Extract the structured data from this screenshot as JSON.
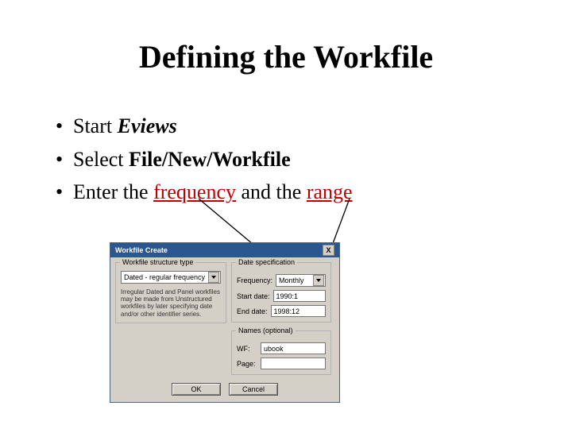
{
  "title": "Defining the Workfile",
  "bullets": {
    "b1_pre": "Start ",
    "b1_em": "Eviews",
    "b2_pre": "Select  ",
    "b2_bold": "File/New/Workfile",
    "b3_pre": "Enter the ",
    "b3_red1": "frequency",
    "b3_mid": " and the ",
    "b3_red2": "range"
  },
  "dialog": {
    "title": "Workfile Create",
    "close": "X",
    "structure_legend": "Workfile structure type",
    "structure_value": "Dated - regular frequency",
    "structure_note": "Irregular Dated and Panel workfiles may be made from Unstructured workfiles by later specifying date and/or other identifier series.",
    "datespec_legend": "Date specification",
    "freq_label": "Frequency:",
    "freq_value": "Monthly",
    "start_label": "Start date:",
    "start_value": "1990:1",
    "end_label": "End date:",
    "end_value": "1998:12",
    "names_legend": "Names (optional)",
    "wf_label": "WF:",
    "wf_value": "ubook",
    "page_label": "Page:",
    "page_value": "",
    "ok": "OK",
    "cancel": "Cancel"
  }
}
